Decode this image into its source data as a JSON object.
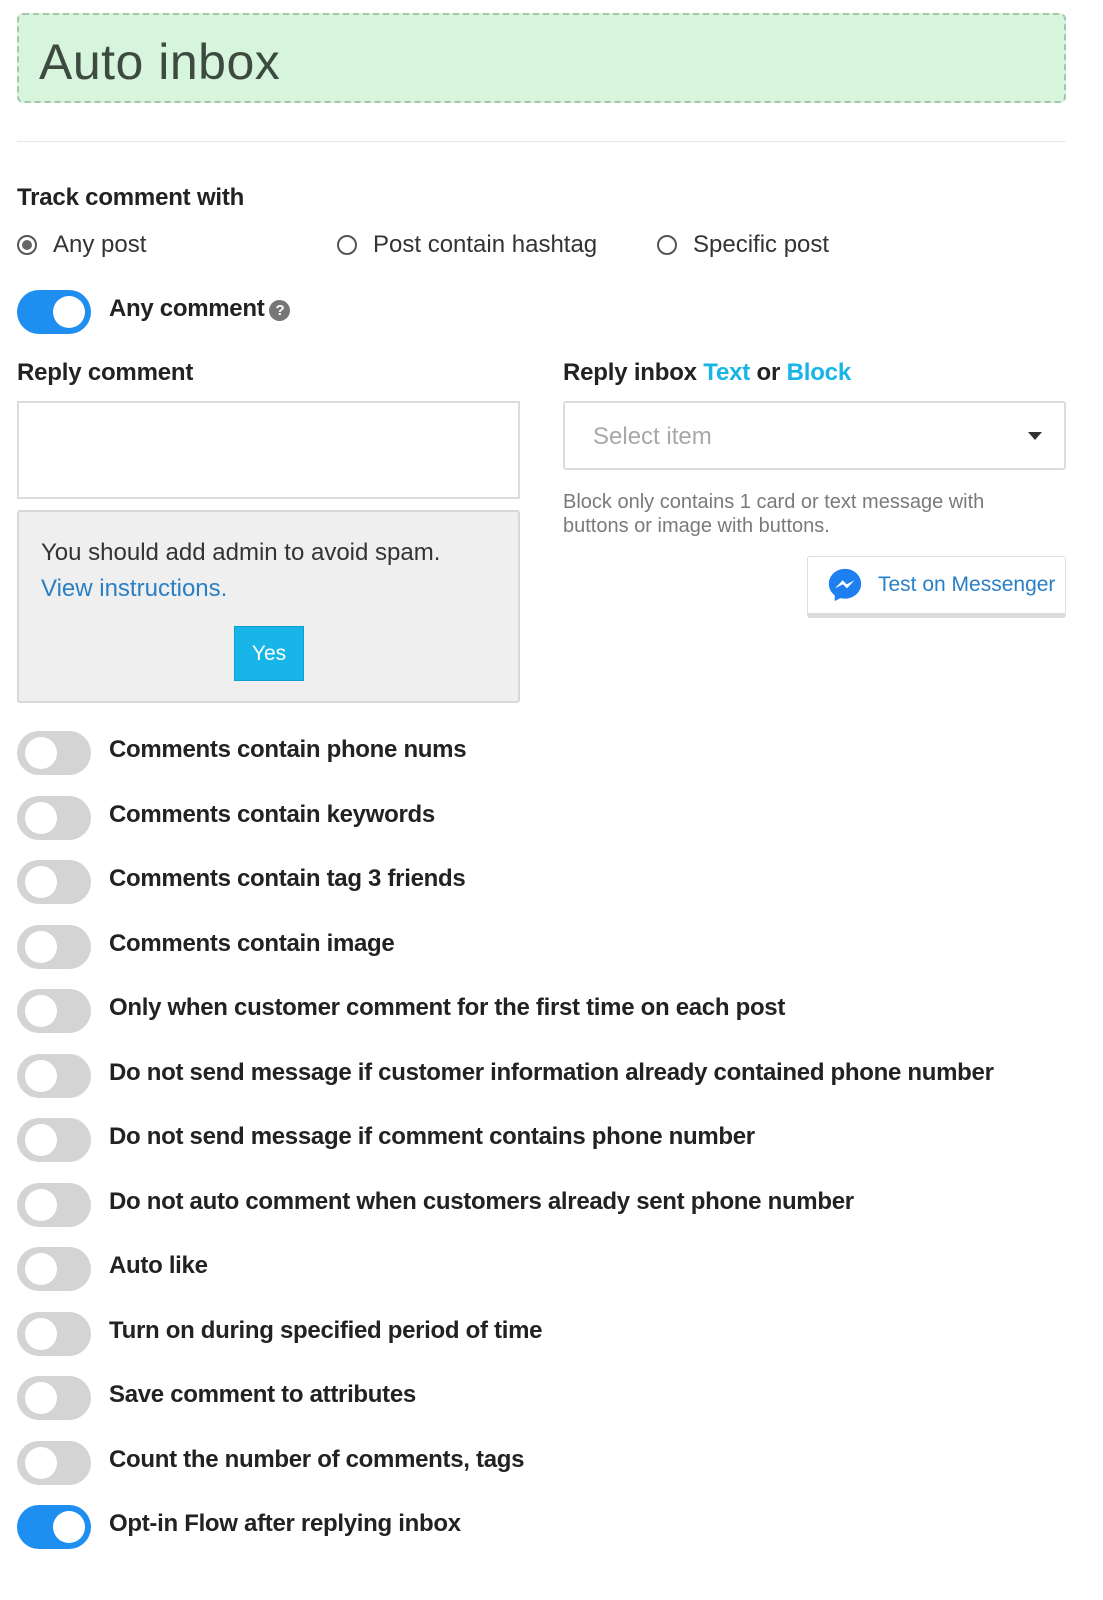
{
  "header": {
    "title": "Auto inbox"
  },
  "track": {
    "label": "Track comment with",
    "options": [
      {
        "label": "Any post",
        "checked": true
      },
      {
        "label": "Post contain hashtag",
        "checked": false
      },
      {
        "label": "Specific post",
        "checked": false
      }
    ]
  },
  "any_comment": {
    "label": "Any comment",
    "on": true,
    "help_icon": "question-circle-icon"
  },
  "reply_comment": {
    "label": "Reply comment",
    "value": ""
  },
  "notice": {
    "text": "You should add admin to avoid spam.",
    "link": "View instructions.",
    "button": "Yes"
  },
  "reply_inbox": {
    "label": "Reply inbox",
    "text_link": "Text",
    "or": "or",
    "block_link": "Block",
    "select_placeholder": "Select item",
    "hint": "Block only contains 1 card or text message with buttons or image with buttons.",
    "messenger_button": "Test on Messenger"
  },
  "options": [
    {
      "label": "Comments contain phone nums",
      "on": false
    },
    {
      "label": "Comments contain keywords",
      "on": false
    },
    {
      "label": "Comments contain tag 3 friends",
      "on": false
    },
    {
      "label": "Comments contain image",
      "on": false
    },
    {
      "label": "Only when customer comment for the first time on each post",
      "on": false
    },
    {
      "label": "Do not send message if customer information already contained phone number",
      "on": false
    },
    {
      "label": "Do not send message if comment contains phone number",
      "on": false
    },
    {
      "label": "Do not auto comment when customers already sent phone number",
      "on": false
    },
    {
      "label": "Auto like",
      "on": false
    },
    {
      "label": "Turn on during specified period of time",
      "on": false
    },
    {
      "label": "Save comment to attributes",
      "on": false
    },
    {
      "label": "Count the number of comments, tags",
      "on": false
    },
    {
      "label": "Opt-in Flow after replying inbox",
      "on": true
    }
  ],
  "colors": {
    "header_bg": "#d6f5dc",
    "toggle_on": "#1e8ef0",
    "toggle_off": "#d4d4d4",
    "link_cyan": "#18b4e6",
    "button_bg": "#17b5e8"
  }
}
